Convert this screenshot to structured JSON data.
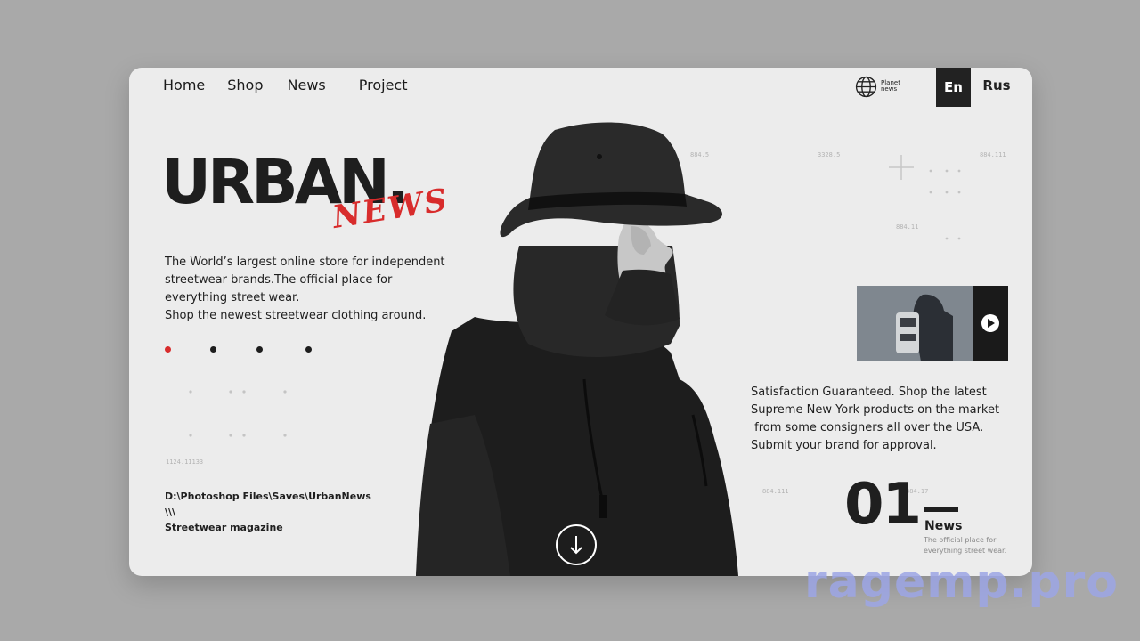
{
  "nav": [
    {
      "label": "Home"
    },
    {
      "label": "Shop"
    },
    {
      "label": "News"
    },
    {
      "label": "Project"
    }
  ],
  "brand": {
    "line1": "Planet",
    "line2": "news"
  },
  "lang": {
    "en": "En",
    "ru": "Rus"
  },
  "hero": {
    "title": "URBAN.",
    "script": "NEWS",
    "intro": [
      "The World’s largest online store for independent",
      "streetwear brands.The official place for",
      "everything street wear.",
      "Shop the newest streetwear clothing around."
    ]
  },
  "micro_labels": {
    "a": "1124.11133",
    "b": "884.5",
    "c": "3328.5",
    "d": "884.111",
    "e": "884.11",
    "f": "884.111",
    "g": "884.17"
  },
  "footer_path": {
    "line1": "D:\\Photoshop Files\\Saves\\UrbanNews",
    "line2": "\\\\\\",
    "line3": "Streetwear magazine"
  },
  "description": [
    "Satisfaction Guaranteed. Shop the latest",
    "Supreme New York products on the market",
    " from some consigners all over the USA.",
    "Submit your brand for approval."
  ],
  "counter": {
    "number": "01",
    "label": "News",
    "sub": "The official place for everything street wear."
  },
  "watermark": "ragemp.pro",
  "colors": {
    "accent": "#d82c2c",
    "dark": "#222222",
    "card": "#ececec"
  }
}
